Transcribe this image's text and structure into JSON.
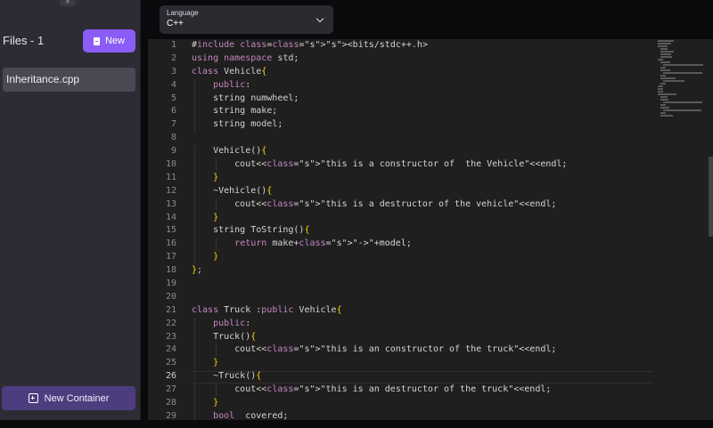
{
  "sidebar": {
    "files_title": "Files - 1",
    "new_button": "New",
    "file_name": "Inheritance.cpp",
    "new_container": "New Container"
  },
  "language": {
    "label": "Language",
    "value": "C++"
  },
  "editor": {
    "line_numbers": [
      "1",
      "2",
      "3",
      "4",
      "5",
      "6",
      "7",
      "8",
      "9",
      "10",
      "11",
      "12",
      "13",
      "14",
      "15",
      "16",
      "17",
      "18",
      "19",
      "20",
      "21",
      "22",
      "23",
      "24",
      "25",
      "26",
      "27",
      "28",
      "29"
    ],
    "lines": [
      "#include <bits/stdc++.h>",
      "using namespace std;",
      "class Vehicle{",
      "    public:",
      "    string numwheel;",
      "    string make;",
      "    string model;",
      "",
      "    Vehicle(){",
      "        cout<<\"this is a constructor of  the Vehicle\"<<endl;",
      "    }",
      "    ~Vehicle(){",
      "        cout<<\"this is a destructor of the vehicle\"<<endl;",
      "    }",
      "    string ToString(){",
      "        return make+\"->\"+model;",
      "    }",
      "};",
      "",
      "",
      "class Truck :public Vehicle{",
      "    public:",
      "    Truck(){",
      "        cout<<\"this is an constructor of the truck\"<<endl;",
      "    }",
      "    ~Truck(){",
      "        cout<<\"this is an destructor of the truck\"<<endl;",
      "    }",
      "    bool  covered;"
    ]
  }
}
